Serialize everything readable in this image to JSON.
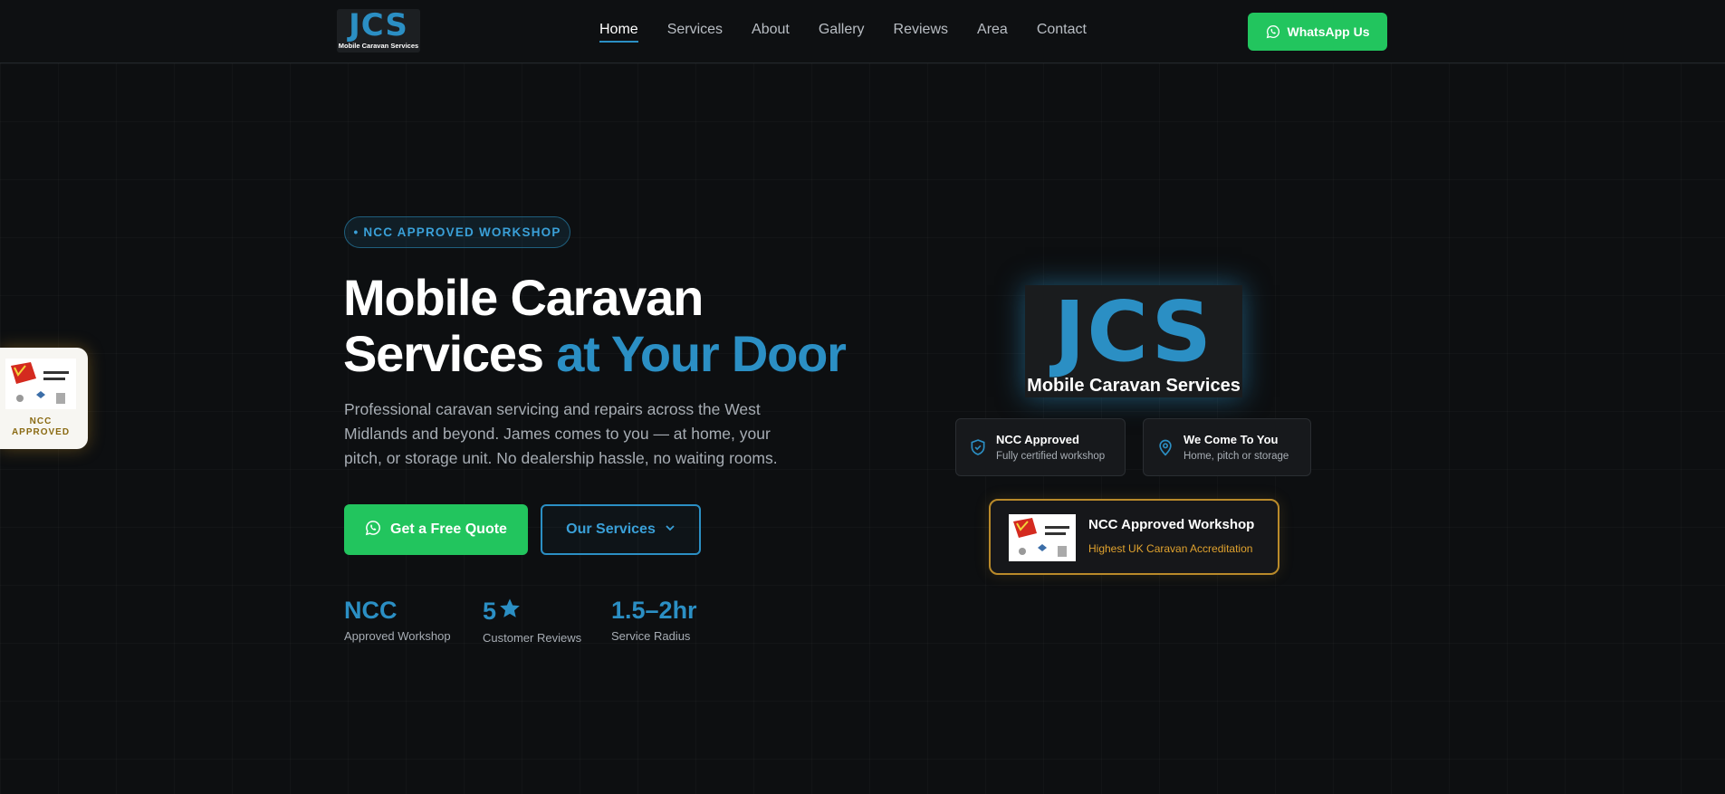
{
  "nav": {
    "logo": {
      "main": "JCS",
      "sub": "Mobile Caravan Services"
    },
    "links": [
      {
        "label": "Home",
        "active": true
      },
      {
        "label": "Services"
      },
      {
        "label": "About"
      },
      {
        "label": "Gallery"
      },
      {
        "label": "Reviews"
      },
      {
        "label": "Area"
      },
      {
        "label": "Contact"
      }
    ],
    "whatsapp_label": "WhatsApp Us"
  },
  "side_badge": {
    "line1": "NCC",
    "line2": "APPROVED"
  },
  "hero": {
    "pill": "• NCC APPROVED WORKSHOP",
    "title_line1": "Mobile Caravan",
    "title_line2_plain": "Services",
    "title_line2_accent": "at Your Door",
    "description": "Professional caravan servicing and repairs across the West Midlands and beyond. James comes to you — at home, your pitch, or storage unit. No dealership hassle, no waiting rooms.",
    "quote_button": "Get a Free Quote",
    "services_button": "Our Services",
    "stats": [
      {
        "value": "NCC",
        "label": "Approved Workshop"
      },
      {
        "value": "5",
        "label": "Customer Reviews"
      },
      {
        "value": "1.5–2hr",
        "label": "Service Radius"
      }
    ]
  },
  "right": {
    "logo": {
      "main": "JCS",
      "sub": "Mobile Caravan Services"
    },
    "features": [
      {
        "title": "NCC Approved",
        "subtitle": "Fully certified workshop",
        "icon": "shield-check-icon"
      },
      {
        "title": "We Come To You",
        "subtitle": "Home, pitch or storage",
        "icon": "map-pin-icon"
      }
    ],
    "ncc_card": {
      "title": "NCC Approved Workshop",
      "subtitle": "Highest UK Caravan Accreditation"
    }
  },
  "colors": {
    "background": "#0d0f11",
    "accent": "#2b8fc4",
    "whatsapp_green": "#22c55e",
    "gold": "#b98a2a"
  }
}
